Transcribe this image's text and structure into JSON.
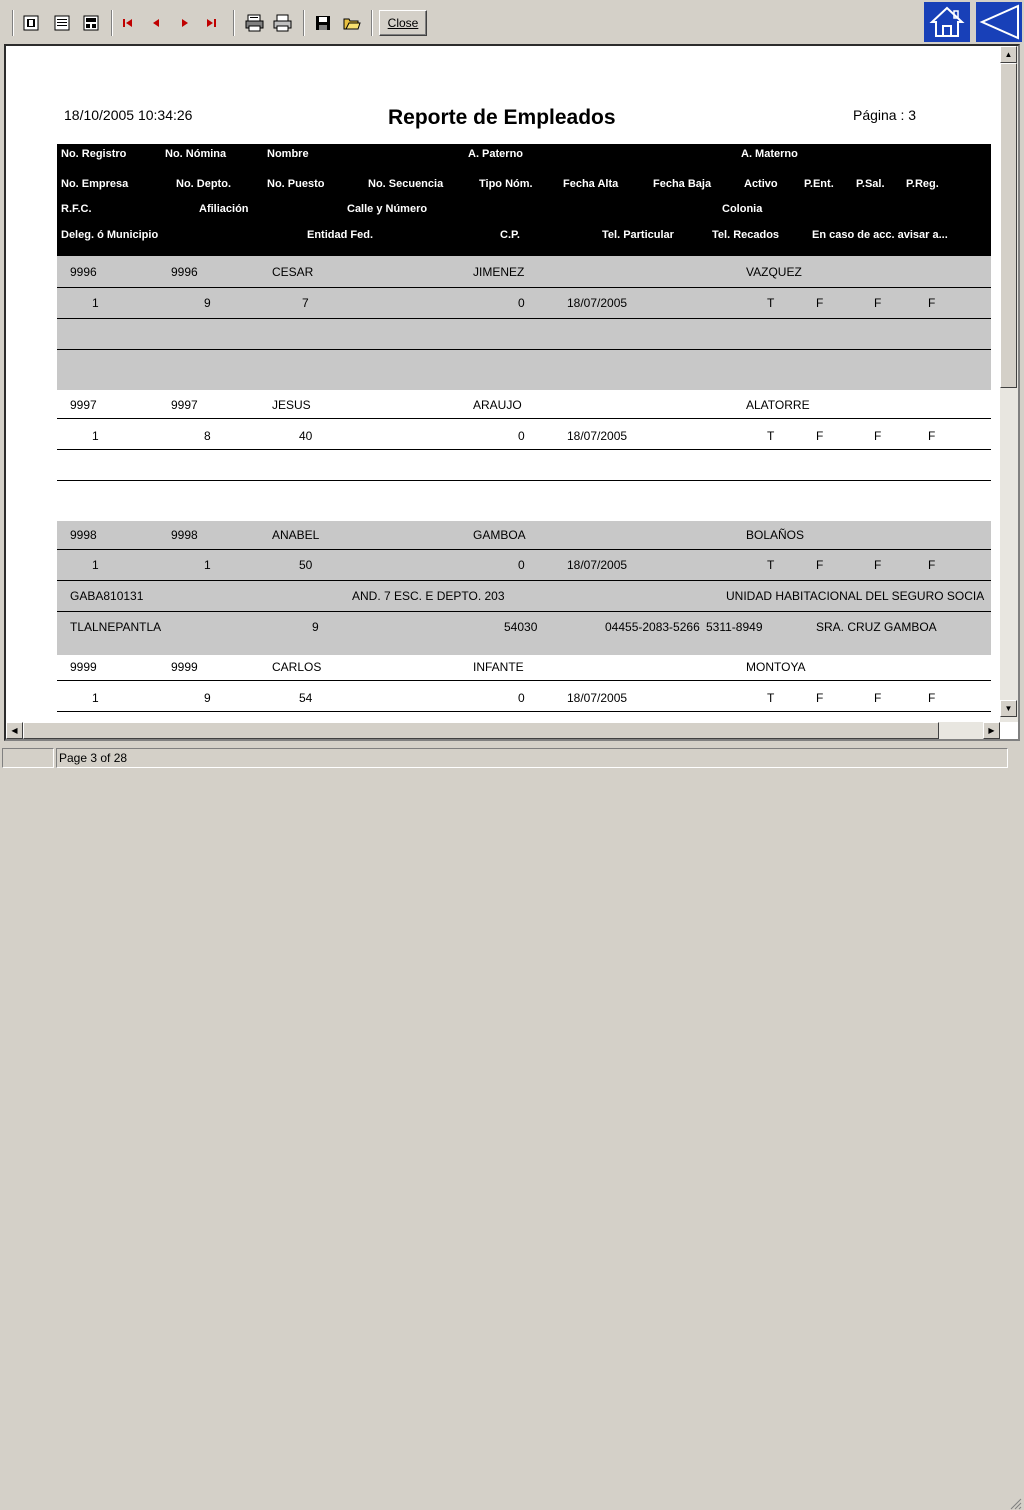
{
  "toolbar": {
    "close_label": "Close",
    "icons": [
      "one-page-icon",
      "two-page-icon",
      "multi-page-icon",
      "first-page-icon",
      "prev-page-icon",
      "next-page-icon",
      "last-page-icon",
      "print-setup-icon",
      "print-icon",
      "save-icon",
      "open-icon"
    ]
  },
  "nav": {
    "home_icon": "home-icon",
    "back_icon": "back-arrow-icon"
  },
  "report": {
    "datetime": "18/10/2005 10:34:26",
    "title": "Reporte de Empleados",
    "page_label": "Página : 3",
    "header_row1": [
      "No. Registro",
      "No. Nómina",
      "Nombre",
      "A. Paterno",
      "A. Materno"
    ],
    "header_row2": [
      "No. Empresa",
      "No. Depto.",
      "No. Puesto",
      "No. Secuencia",
      "Tipo Nóm.",
      "Fecha Alta",
      "Fecha Baja",
      "Activo",
      "P.Ent.",
      "P.Sal.",
      "P.Reg."
    ],
    "header_row3": [
      "R.F.C.",
      "Afiliación",
      "Calle y Número",
      "Colonia"
    ],
    "header_row4": [
      "Deleg. ó Municipio",
      "Entidad Fed.",
      "C.P.",
      "Tel. Particular",
      "Tel. Recados",
      "En caso de acc. avisar a..."
    ],
    "records": [
      {
        "registro": "9996",
        "nomina": "9996",
        "nombre": "CESAR",
        "paterno": "JIMENEZ",
        "materno": "VAZQUEZ",
        "empresa": "1",
        "depto": "9",
        "puesto": "7",
        "tipo_nom": "0",
        "fecha_alta": "18/07/2005",
        "activo": "T",
        "p_ent": "F",
        "p_sal": "F",
        "p_reg": "F"
      },
      {
        "registro": "9997",
        "nomina": "9997",
        "nombre": "JESUS",
        "paterno": "ARAUJO",
        "materno": "ALATORRE",
        "empresa": "1",
        "depto": "8",
        "puesto": "40",
        "tipo_nom": "0",
        "fecha_alta": "18/07/2005",
        "activo": "T",
        "p_ent": "F",
        "p_sal": "F",
        "p_reg": "F"
      },
      {
        "registro": "9998",
        "nomina": "9998",
        "nombre": "ANABEL",
        "paterno": "GAMBOA",
        "materno": "BOLAÑOS",
        "empresa": "1",
        "depto": "1",
        "puesto": "50",
        "tipo_nom": "0",
        "fecha_alta": "18/07/2005",
        "activo": "T",
        "p_ent": "F",
        "p_sal": "F",
        "p_reg": "F",
        "rfc": "GABA810131",
        "calle": "AND. 7 ESC. E DEPTO. 203",
        "colonia": "UNIDAD HABITACIONAL DEL SEGURO SOCIA",
        "municipio": "TLALNEPANTLA",
        "entidad": "9",
        "cp": "54030",
        "tel_part": "04455-2083-5266",
        "tel_rec": "5311-8949",
        "avisar": "SRA. CRUZ GAMBOA"
      },
      {
        "registro": "9999",
        "nomina": "9999",
        "nombre": "CARLOS",
        "paterno": "INFANTE",
        "materno": "MONTOYA",
        "empresa": "1",
        "depto": "9",
        "puesto": "54",
        "tipo_nom": "0",
        "fecha_alta": "18/07/2005",
        "activo": "T",
        "p_ent": "F",
        "p_sal": "F",
        "p_reg": "F"
      }
    ]
  },
  "statusbar": {
    "page_info": "Page 3 of 28"
  },
  "colors": {
    "nav_blue": "#1840b8",
    "header_bg": "#000000",
    "row_grey": "#c8c8c8"
  }
}
